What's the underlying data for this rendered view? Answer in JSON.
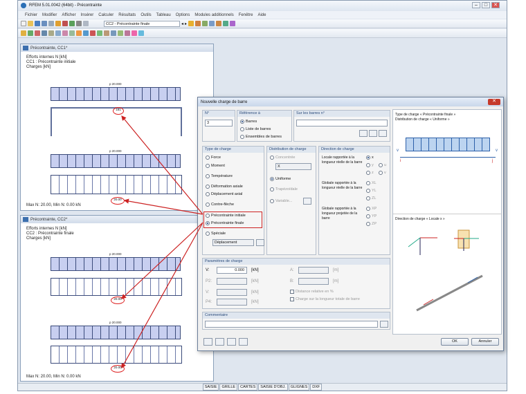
{
  "app": {
    "title": "RFEM 5.01.0042 (64bit) - Précontrainte",
    "min": "–",
    "max": "□",
    "close": "✕"
  },
  "menu": [
    "Fichier",
    "Modifier",
    "Afficher",
    "Insérer",
    "Calculer",
    "Résultats",
    "Outils",
    "Tableau",
    "Options",
    "Modules additionnels",
    "Fenêtre",
    "Aide"
  ],
  "toolbar": {
    "loadcase": "CC2 - Précontrainte finale",
    "prev": "◂",
    "next": "▸"
  },
  "win1": {
    "title": "Précontrainte, CC1*",
    "lines": [
      "Efforts internes N [kN]",
      "CC1 : Précontrainte initiale",
      "Charges [kN]"
    ],
    "p1": "p 20.000",
    "p2": "p 20.000",
    "v1": "181",
    "v2": "20.00",
    "footer": "Max N: 20.00, Min N: 0.00 kN"
  },
  "win2": {
    "title": "Précontrainte, CC2*",
    "lines": [
      "Efforts internes N [kN]",
      "CC2 : Précontrainte finale",
      "Charges [kN]"
    ],
    "p1": "p 20.000",
    "p2": "p 20.000",
    "v1": "20.00",
    "v2": "20.00",
    "footer": "Max N: 20.00, Min N: 0.00 kN"
  },
  "dialog": {
    "title": "Nouvelle charge de barre",
    "no_label": "N°",
    "no_value": "3",
    "ref_label": "Référence à",
    "ref_options": [
      "Barres",
      "Liste de barres",
      "Ensembles de barres"
    ],
    "on_label": "Sur les barres n°",
    "type_label": "Type de charge",
    "types": [
      "Force",
      "Moment",
      "Température",
      "Déformation axiale",
      "Déplacement axial",
      "Contre-flèche",
      "Précontrainte initiale",
      "Précontrainte finale",
      "Spéciale"
    ],
    "special_value": "Déplacement",
    "dist_label": "Distribution de charge",
    "dists": [
      "Concentrée",
      "Uniforme",
      "Trapézoïdale",
      "Variable..."
    ],
    "dist_x": "X",
    "dir_label": "Direction de charge",
    "dir_local": "Locale rapportée à la longueur réelle de la barre",
    "dir_global_real": "Globale rapportée à la longueur réelle de la barre",
    "dir_global_proj": "Globale rapportée à la longueur projetée de la barre",
    "dir_local_opts": [
      "x",
      "y",
      "u",
      "z",
      "v"
    ],
    "dir_global_opts": [
      "XL",
      "YL",
      "ZL"
    ],
    "dir_proj_opts": [
      "XP",
      "YP",
      "ZP"
    ],
    "params_label": "Paramètres de charge",
    "params_left": [
      {
        "sym": "V:",
        "val": "0.000",
        "unit": "[kN]"
      },
      {
        "sym": "P2:",
        "val": "",
        "unit": "[kN]"
      },
      {
        "sym": "V:",
        "val": "",
        "unit": "[kN]"
      },
      {
        "sym": "P4:",
        "val": "",
        "unit": "[kN]"
      }
    ],
    "params_right": [
      {
        "sym": "A:",
        "unit": "[m]"
      },
      {
        "sym": "B:",
        "unit": "[m]"
      }
    ],
    "rel_dist": "Distance relative en %",
    "total_len": "Charge sur la longueur totale de barre",
    "comment_label": "Commentaire",
    "ok": "OK",
    "cancel": "Annuler",
    "info_title": "Type de charge « Précontrainte finale »",
    "info_sub": "Distribution de charge « Uniforme »",
    "dir_info": "Direction de charge « Locale x »",
    "diag_v": "v",
    "diag_i": "i",
    "diag_j": "j"
  },
  "status": [
    "SAISIE",
    "GRILLE",
    "CARTES",
    "SAISIE D'OBJ.",
    "GLIGNES",
    "DXF"
  ],
  "colors": {
    "accent": "#2b5f9e",
    "highlight": "#cc2222"
  }
}
